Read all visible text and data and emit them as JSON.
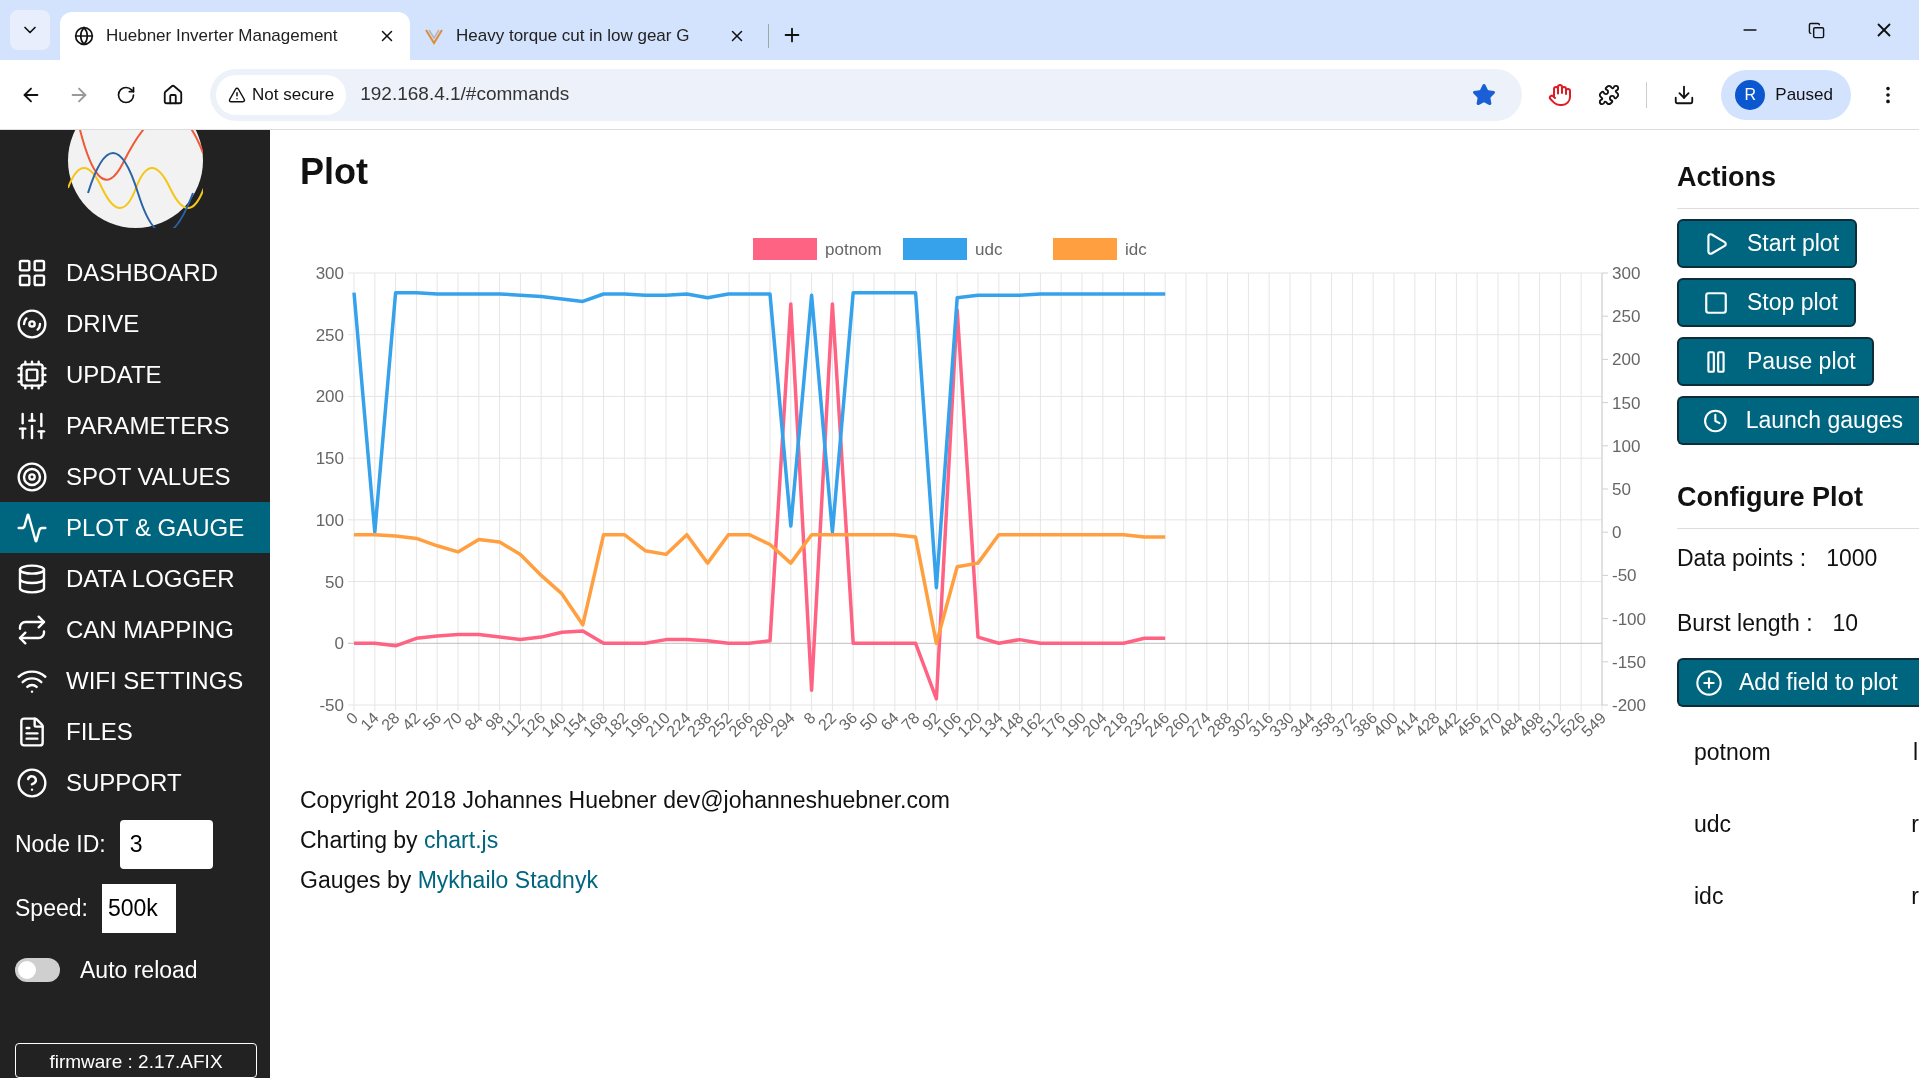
{
  "browser": {
    "tabs": [
      {
        "title": "Huebner Inverter Management",
        "selected": true
      },
      {
        "title": "Heavy torque cut in low gear G",
        "selected": false
      }
    ],
    "security": "Not secure",
    "url": "192.168.4.1/#commands",
    "bookmarked": true,
    "profile_initial": "R",
    "profile_status": "Paused"
  },
  "sidebar": {
    "items": [
      {
        "label": "DASHBOARD",
        "kind": "grid",
        "selected": false
      },
      {
        "label": "DRIVE",
        "kind": "wheel",
        "selected": false
      },
      {
        "label": "UPDATE",
        "kind": "chip",
        "selected": false
      },
      {
        "label": "PARAMETERS",
        "kind": "sliders",
        "selected": false
      },
      {
        "label": "SPOT VALUES",
        "kind": "target",
        "selected": false
      },
      {
        "label": "PLOT & GAUGE",
        "kind": "pulse",
        "selected": true
      },
      {
        "label": "DATA LOGGER",
        "kind": "database",
        "selected": false
      },
      {
        "label": "CAN MAPPING",
        "kind": "repeat",
        "selected": false
      },
      {
        "label": "WIFI SETTINGS",
        "kind": "wifi",
        "selected": false
      },
      {
        "label": "FILES",
        "kind": "file",
        "selected": false
      },
      {
        "label": "SUPPORT",
        "kind": "help",
        "selected": false
      }
    ],
    "node_id": {
      "label": "Node ID:",
      "value": "3"
    },
    "speed": {
      "label": "Speed:",
      "value": "500k"
    },
    "auto_reload": {
      "label": "Auto reload",
      "on": false
    },
    "firmware": "firmware : 2.17.AFIX"
  },
  "plot": {
    "title": "Plot",
    "chart_data": {
      "type": "line",
      "categories": [
        "0",
        "14",
        "28",
        "42",
        "56",
        "70",
        "84",
        "98",
        "112",
        "126",
        "140",
        "154",
        "168",
        "182",
        "196",
        "210",
        "224",
        "238",
        "252",
        "266",
        "280",
        "294",
        "8",
        "22",
        "36",
        "50",
        "64",
        "78",
        "92",
        "106",
        "120",
        "134",
        "148",
        "162",
        "176",
        "190",
        "204",
        "218",
        "232",
        "246",
        "260",
        "274",
        "288",
        "302",
        "316",
        "330",
        "344",
        "358",
        "372",
        "386",
        "400",
        "414",
        "428",
        "442",
        "456",
        "470",
        "484",
        "498",
        "512",
        "526",
        "549"
      ],
      "series": [
        {
          "name": "potnom",
          "color": "#ff6384",
          "values": [
            0,
            0,
            -2,
            4,
            6,
            7,
            7,
            5,
            3,
            5,
            9,
            10,
            0,
            0,
            0,
            3,
            3,
            2,
            0,
            0,
            2,
            275,
            -38,
            275,
            0,
            0,
            0,
            0,
            -45,
            270,
            5,
            0,
            3,
            0,
            0,
            0,
            0,
            0,
            4,
            4,
            null,
            null,
            null,
            null,
            null,
            null,
            null,
            null,
            null,
            null,
            null,
            null,
            null,
            null,
            null,
            null,
            null,
            null,
            null,
            null,
            null
          ]
        },
        {
          "name": "udc",
          "color": "#36a2eb",
          "values": [
            284,
            90,
            284,
            284,
            283,
            283,
            283,
            283,
            282,
            281,
            279,
            277,
            283,
            283,
            282,
            282,
            283,
            280,
            283,
            283,
            283,
            95,
            282,
            90,
            284,
            284,
            284,
            284,
            45,
            280,
            282,
            282,
            282,
            283,
            283,
            283,
            283,
            283,
            283,
            283,
            null,
            null,
            null,
            null,
            null,
            null,
            null,
            null,
            null,
            null,
            null,
            null,
            null,
            null,
            null,
            null,
            null,
            null,
            null,
            null,
            null
          ]
        },
        {
          "name": "idc",
          "color": "#ff9f40",
          "values": [
            88,
            88,
            87,
            85,
            79,
            74,
            84,
            82,
            72,
            55,
            40,
            15,
            88,
            88,
            75,
            72,
            88,
            65,
            88,
            88,
            80,
            65,
            88,
            88,
            88,
            88,
            88,
            86,
            0,
            62,
            65,
            88,
            88,
            88,
            88,
            88,
            88,
            88,
            86,
            86,
            null,
            null,
            null,
            null,
            null,
            null,
            null,
            null,
            null,
            null,
            null,
            null,
            null,
            null,
            null,
            null,
            null,
            null,
            null,
            null,
            null
          ]
        }
      ],
      "ylim": [
        -50,
        300
      ],
      "yticks": [
        -50,
        0,
        50,
        100,
        150,
        200,
        250,
        300
      ],
      "grid": true,
      "legend": "top"
    },
    "right_axis_labels": [
      "300",
      "250",
      "200",
      "150",
      "100",
      "50",
      "0",
      "-50",
      "-100",
      "-150",
      "-200"
    ]
  },
  "footer": {
    "copyright": "Copyright 2018 Johannes Huebner dev@johanneshuebner.com",
    "charting": "Charting by ",
    "charting_link": "chart.js",
    "gauges": "Gauges by ",
    "gauges_link": "Mykhailo Stadnyk"
  },
  "actions": {
    "title": "Actions",
    "buttons": [
      {
        "label": "Start plot",
        "kind": "play"
      },
      {
        "label": "Stop plot",
        "kind": "stop"
      },
      {
        "label": "Pause plot",
        "kind": "pause"
      },
      {
        "label": "Launch gauges",
        "kind": "clock"
      }
    ]
  },
  "configure": {
    "title": "Configure Plot",
    "data_points": {
      "label": "Data points :",
      "value": "1000"
    },
    "burst_length": {
      "label": "Burst length :",
      "value": "10"
    },
    "add_button": "Add field to plot",
    "fields": [
      {
        "name": "potnom",
        "column_2": "l"
      },
      {
        "name": "udc",
        "column_2": "r"
      },
      {
        "name": "idc",
        "column_2": "r"
      }
    ]
  }
}
